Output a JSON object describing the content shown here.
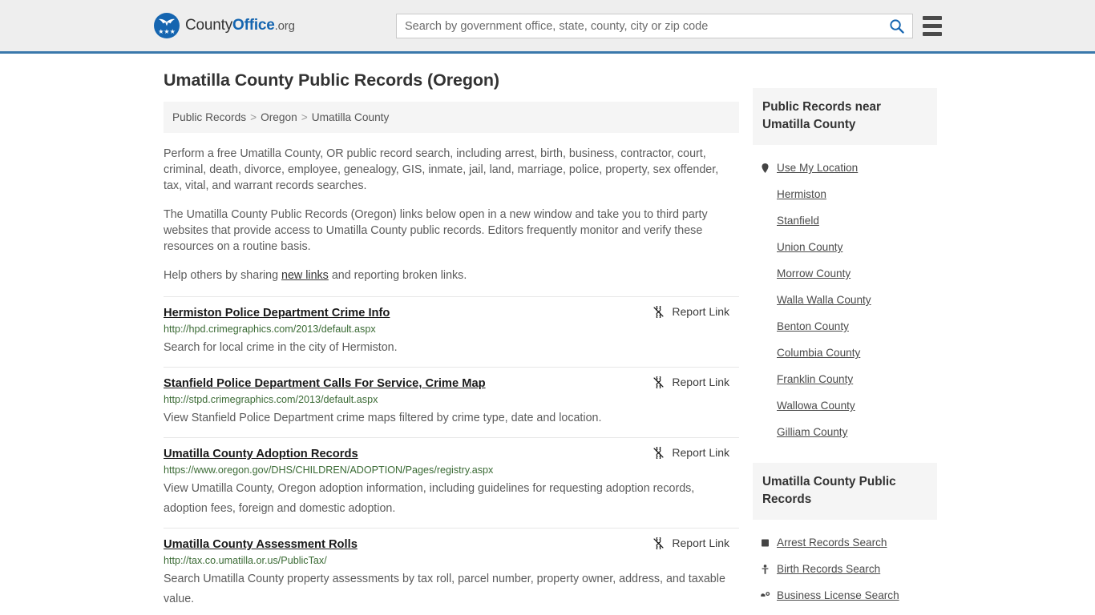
{
  "header": {
    "logo": {
      "text_county": "County",
      "text_office": "Office",
      "text_tld": ".org",
      "icon": "eagle-shield-icon"
    },
    "search": {
      "placeholder": "Search by government office, state, county, city or zip code",
      "value": "",
      "icon": "search-icon"
    },
    "menu_icon": "hamburger-menu-icon"
  },
  "main": {
    "title": "Umatilla County Public Records (Oregon)",
    "breadcrumb": [
      {
        "label": "Public Records"
      },
      {
        "label": "Oregon"
      },
      {
        "label": "Umatilla County"
      }
    ],
    "breadcrumb_separator": ">",
    "paragraphs": [
      "Perform a free Umatilla County, OR public record search, including arrest, birth, business, contractor, court, criminal, death, divorce, employee, genealogy, GIS, inmate, jail, land, marriage, police, property, sex offender, tax, vital, and warrant records searches.",
      "The Umatilla County Public Records (Oregon) links below open in a new window and take you to third party websites that provide access to Umatilla County public records. Editors frequently monitor and verify these resources on a routine basis."
    ],
    "help_line": {
      "before": "Help others by sharing ",
      "link": "new links",
      "after": " and reporting broken links."
    },
    "report_link_label": "Report Link",
    "report_link_icon": "broken-link-icon",
    "records": [
      {
        "title": "Hermiston Police Department Crime Info",
        "url": "http://hpd.crimegraphics.com/2013/default.aspx",
        "description": "Search for local crime in the city of Hermiston."
      },
      {
        "title": "Stanfield Police Department Calls For Service, Crime Map",
        "url": "http://stpd.crimegraphics.com/2013/default.aspx",
        "description": "View Stanfield Police Department crime maps filtered by crime type, date and location."
      },
      {
        "title": "Umatilla County Adoption Records",
        "url": "https://www.oregon.gov/DHS/CHILDREN/ADOPTION/Pages/registry.aspx",
        "description": "View Umatilla County, Oregon adoption information, including guidelines for requesting adoption records, adoption fees, foreign and domestic adoption."
      },
      {
        "title": "Umatilla County Assessment Rolls",
        "url": "http://tax.co.umatilla.or.us/PublicTax/",
        "description": "Search Umatilla County property assessments by tax roll, parcel number, property owner, address, and taxable value."
      }
    ]
  },
  "sidebar": {
    "nearby": {
      "heading": "Public Records near Umatilla County",
      "items": [
        {
          "label": "Use My Location",
          "icon": "map-pin-icon"
        },
        {
          "label": "Hermiston",
          "icon": ""
        },
        {
          "label": "Stanfield",
          "icon": ""
        },
        {
          "label": "Union County",
          "icon": ""
        },
        {
          "label": "Morrow County",
          "icon": ""
        },
        {
          "label": "Walla Walla County",
          "icon": ""
        },
        {
          "label": "Benton County",
          "icon": ""
        },
        {
          "label": "Columbia County",
          "icon": ""
        },
        {
          "label": "Franklin County",
          "icon": ""
        },
        {
          "label": "Wallowa County",
          "icon": ""
        },
        {
          "label": "Gilliam County",
          "icon": ""
        }
      ]
    },
    "records": {
      "heading": "Umatilla County Public Records",
      "items": [
        {
          "label": "Arrest Records Search",
          "icon": "fingerprint-icon"
        },
        {
          "label": "Birth Records Search",
          "icon": "baby-icon"
        },
        {
          "label": "Business License Search",
          "icon": "briefcase-gear-icon"
        }
      ]
    }
  },
  "colors": {
    "brand_blue": "#1565b0",
    "header_rule": "#3a78ab",
    "url_green": "#3b6b35",
    "panel_gray": "#f5f5f5"
  }
}
